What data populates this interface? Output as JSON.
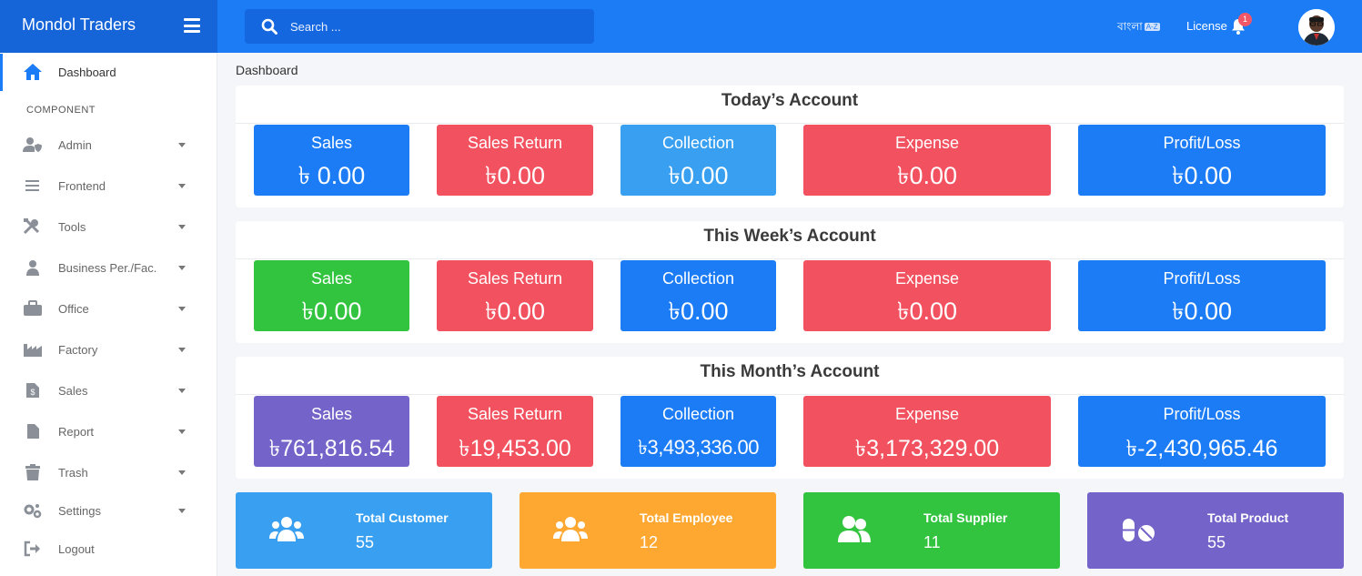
{
  "brand": {
    "name": "Mondol Traders"
  },
  "search": {
    "placeholder": "Search ..."
  },
  "header": {
    "language": "বাংলা",
    "language_badge": "A-Z",
    "license": "License",
    "notification_count": "1"
  },
  "sidebar": {
    "dashboard_label": "Dashboard",
    "section_label": "COMPONENT",
    "items": [
      {
        "label": "Admin",
        "icon": "user-shield-icon"
      },
      {
        "label": "Frontend",
        "icon": "bars-icon"
      },
      {
        "label": "Tools",
        "icon": "tools-icon"
      },
      {
        "label": "Business Per./Fac.",
        "icon": "user-tie-icon"
      },
      {
        "label": "Office",
        "icon": "briefcase-icon"
      },
      {
        "label": "Factory",
        "icon": "industry-icon"
      },
      {
        "label": "Sales",
        "icon": "file-invoice-dollar-icon"
      },
      {
        "label": "Report",
        "icon": "file-icon"
      },
      {
        "label": "Trash",
        "icon": "trash-icon"
      },
      {
        "label": "Settings",
        "icon": "cogs-icon"
      },
      {
        "label": "Logout",
        "icon": "sign-out-icon"
      }
    ]
  },
  "breadcrumb": "Dashboard",
  "accounts": [
    {
      "title": "Today’s Account",
      "cards": [
        {
          "label": "Sales",
          "value": "৳ 0.00",
          "color": "#1c7cf5"
        },
        {
          "label": "Sales Return",
          "value": "৳0.00",
          "color": "#f2525f"
        },
        {
          "label": "Collection",
          "value": "৳0.00",
          "color": "#39a0f1"
        },
        {
          "label": "Expense",
          "value": "৳0.00",
          "color": "#f2525f"
        },
        {
          "label": "Profit/Loss",
          "value": "৳0.00",
          "color": "#1c7cf5"
        }
      ]
    },
    {
      "title": "This Week’s Account",
      "cards": [
        {
          "label": "Sales",
          "value": "৳0.00",
          "color": "#33c43f"
        },
        {
          "label": "Sales Return",
          "value": "৳0.00",
          "color": "#f2525f"
        },
        {
          "label": "Collection",
          "value": "৳0.00",
          "color": "#1c7cf5"
        },
        {
          "label": "Expense",
          "value": "৳0.00",
          "color": "#f2525f"
        },
        {
          "label": "Profit/Loss",
          "value": "৳0.00",
          "color": "#1c7cf5"
        }
      ]
    },
    {
      "title": "This Month’s Account",
      "cards": [
        {
          "label": "Sales",
          "value": "৳761,816.54",
          "color": "#7463c8"
        },
        {
          "label": "Sales Return",
          "value": "৳19,453.00",
          "color": "#f2525f"
        },
        {
          "label": "Collection",
          "value": "৳3,493,336.00",
          "color": "#1c7cf5"
        },
        {
          "label": "Expense",
          "value": "৳3,173,329.00",
          "color": "#f2525f"
        },
        {
          "label": "Profit/Loss",
          "value": "৳-2,430,965.46",
          "color": "#1c7cf5"
        }
      ]
    }
  ],
  "totals": [
    {
      "title": "Total Customer",
      "value": "55",
      "color": "#39a0f1",
      "icon": "users-icon"
    },
    {
      "title": "Total Employee",
      "value": "12",
      "color": "#fea831",
      "icon": "users-icon"
    },
    {
      "title": "Total Supplier",
      "value": "11",
      "color": "#33c43f",
      "icon": "user-friends-icon"
    },
    {
      "title": "Total Product",
      "value": "55",
      "color": "#7463c8",
      "icon": "pills-icon"
    }
  ]
}
